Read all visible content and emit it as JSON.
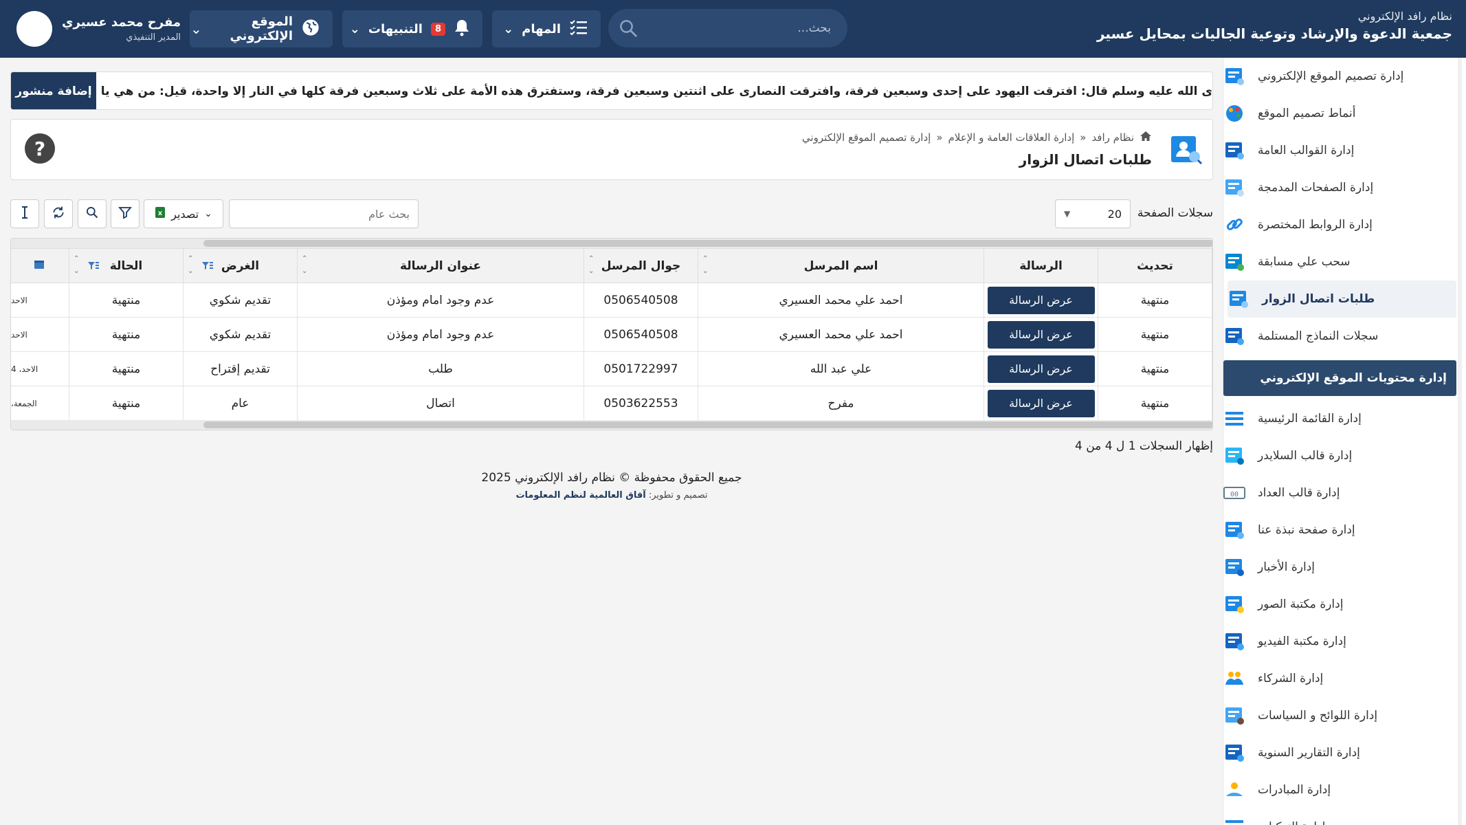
{
  "topbar": {
    "system_name": "نظام رافد الإلكتروني",
    "org_name": "جمعية الدعوة والإرشاد وتوعية الجاليات بمحايل عسير",
    "search_placeholder": "بحث...",
    "tasks_label": "المهام",
    "notifications_label": "التنبيهات",
    "notifications_count": "8",
    "website_label": "الموقع الإلكتروني",
    "user_name": "مفرح محمد عسيري",
    "user_role": "المدير التنفيذي"
  },
  "sidebar": {
    "items_top": [
      {
        "label": "إدارة تصميم الموقع الإلكتروني",
        "icon": "monitor-design-icon"
      },
      {
        "label": "أنماط تصميم الموقع",
        "icon": "palette-icon"
      },
      {
        "label": "إدارة القوالب العامة",
        "icon": "template-icon"
      },
      {
        "label": "إدارة الصفحات المدمجة",
        "icon": "pages-icon"
      },
      {
        "label": "إدارة الروابط المختصرة",
        "icon": "link-icon"
      },
      {
        "label": "سحب علي مسابقة",
        "icon": "draw-icon"
      },
      {
        "label": "طلبات اتصال الزوار",
        "icon": "contact-requests-icon"
      },
      {
        "label": "سجلات النماذج المستلمة",
        "icon": "forms-icon"
      }
    ],
    "section_label": "إدارة محتويات الموقع الإلكتروني",
    "items_bottom": [
      {
        "label": "إدارة القائمة الرئيسية",
        "icon": "menu-icon"
      },
      {
        "label": "إدارة قالب السلايدر",
        "icon": "slider-icon"
      },
      {
        "label": "إدارة قالب العداد",
        "icon": "counter-icon"
      },
      {
        "label": "إدارة صفحة نبذة عنا",
        "icon": "about-icon"
      },
      {
        "label": "إدارة الأخبار",
        "icon": "news-icon"
      },
      {
        "label": "إدارة مكتبة الصور",
        "icon": "image-gallery-icon"
      },
      {
        "label": "إدارة مكتبة الفيديو",
        "icon": "video-library-icon"
      },
      {
        "label": "إدارة الشركاء",
        "icon": "partners-icon"
      },
      {
        "label": "إدارة اللوائح و السياسات",
        "icon": "policies-icon"
      },
      {
        "label": "إدارة التقارير السنوية",
        "icon": "reports-icon"
      },
      {
        "label": "إدارة المبادرات",
        "icon": "initiatives-icon"
      },
      {
        "label": "إدارة التزكيات",
        "icon": "list-icon"
      }
    ]
  },
  "ticker": {
    "text": "ى الله عليه وسلم قال: افترقت اليهود على إحدى وسبعين فرقة، وافترقت النصارى على اثنتين وسبعين فرقة، وستفترق هذه الأمة على ثلاث وسبعين فرقة كلها في النار إلا واحدة، قيل: من هي يا رسول الله؟ قال: من كان على",
    "add_post_label": "إضافة منشور"
  },
  "page": {
    "breadcrumb": [
      "نظام رافد",
      "إدارة العلاقات العامة و الإعلام",
      "إدارة تصميم الموقع الإلكتروني"
    ],
    "breadcrumb_sep": "«",
    "title": "طلبات اتصال الزوار",
    "help_label": "?"
  },
  "toolbar": {
    "page_size_label": "سجلات الصفحة",
    "page_size_value": "20",
    "search_placeholder": "بحث عام",
    "export_label": "تصدير"
  },
  "table": {
    "columns": [
      "تحديث",
      "الرسالة",
      "اسم المرسل",
      "جوال المرسل",
      "عنوان الرسالة",
      "الغرض",
      "الحالة"
    ],
    "view_label": "عرض الرسالة",
    "rows": [
      {
        "update": "منتهية",
        "sender": "احمد علي محمد العسيري",
        "mobile": "0506540508",
        "subject": "عدم وجود امام ومؤذن",
        "purpose": "تقديم شكوي",
        "status": "منتهية",
        "extra": "الاحد"
      },
      {
        "update": "منتهية",
        "sender": "احمد علي محمد العسيري",
        "mobile": "0506540508",
        "subject": "عدم وجود امام ومؤذن",
        "purpose": "تقديم شكوي",
        "status": "منتهية",
        "extra": "الاحد"
      },
      {
        "update": "منتهية",
        "sender": "علي عبد الله",
        "mobile": "0501722997",
        "subject": "طلب",
        "purpose": "تقديم إقتراح",
        "status": "منتهية",
        "extra": "الاحد، 4"
      },
      {
        "update": "منتهية",
        "sender": "مفرح",
        "mobile": "0503622553",
        "subject": "اتصال",
        "purpose": "عام",
        "status": "منتهية",
        "extra": "الجمعة،"
      }
    ]
  },
  "pagination": {
    "showing_text": "إظهار السجلات 1 ل 4 من 4"
  },
  "footer": {
    "copyright": "جميع الحقوق محفوظة © نظام رافد الإلكتروني 2025",
    "credit_prefix": "تصميم و تطوير:",
    "credit_company": "آفاق العالمية لنظم المعلومات"
  },
  "colors": {
    "primary": "#1f3a5e",
    "primary_light": "#2c4a72",
    "badge": "#e53935"
  }
}
